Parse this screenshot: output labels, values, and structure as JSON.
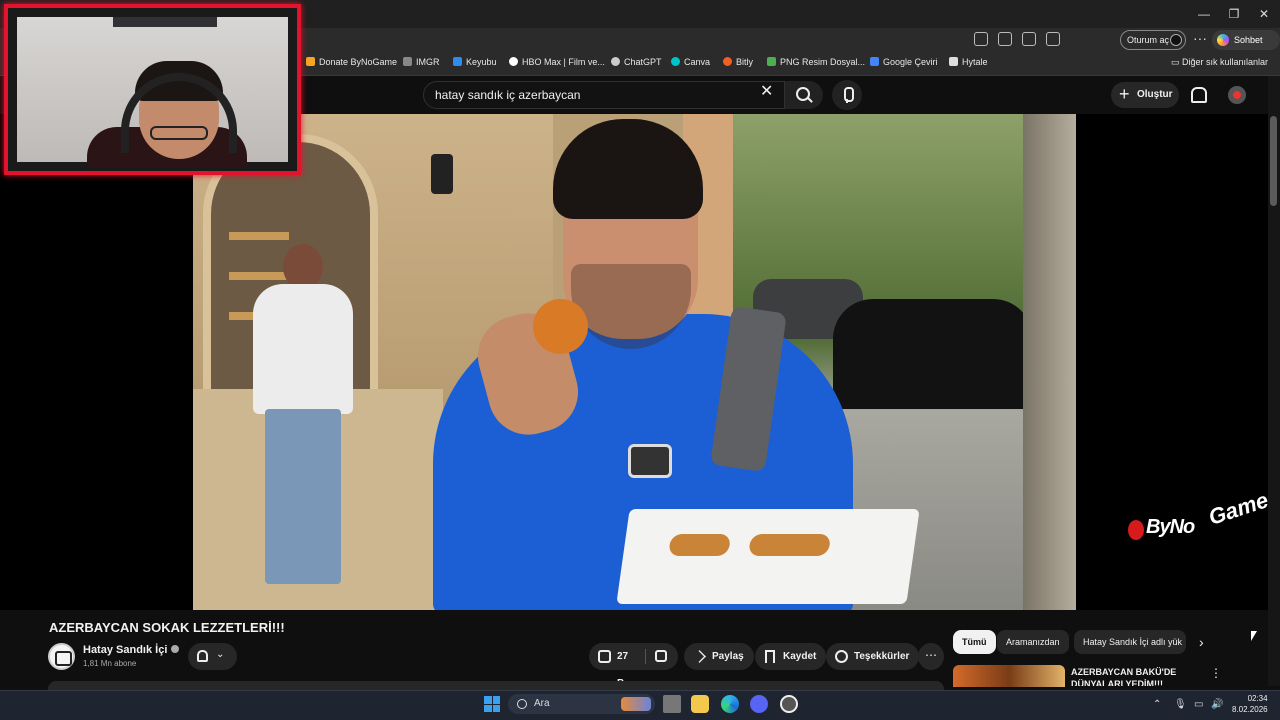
{
  "browser": {
    "sign_in_label": "Oturum aç",
    "copilot_label": "Sohbet et",
    "window_controls": [
      "minimize",
      "maximize",
      "close"
    ],
    "bookmarks": [
      {
        "label": "Donate ByNoGame",
        "color": "#f5a623"
      },
      {
        "label": "IMGR",
        "color": "#888888"
      },
      {
        "label": "Keyubu",
        "color": "#2d8cf0"
      },
      {
        "label": "HBO Max | Film ve...",
        "color": "#ffffff"
      },
      {
        "label": "ChatGPT",
        "color": "#cccccc"
      },
      {
        "label": "Canva",
        "color": "#00c4cc"
      },
      {
        "label": "Bitly",
        "color": "#ee6123"
      },
      {
        "label": "PNG Resim Dosyal...",
        "color": "#4caf50"
      },
      {
        "label": "Google Çeviri",
        "color": "#4285f4"
      },
      {
        "label": "Hytale",
        "color": "#dddddd"
      }
    ],
    "other_bookmarks_label": "Diğer sık kullanılanlar"
  },
  "youtube": {
    "search_query": "hatay sandık iç azerbaycan",
    "create_label": "Oluştur",
    "video": {
      "title": "AZERBAYCAN SOKAK LEZZETLERİ!!!",
      "watermark_line1": "ByNo",
      "watermark_line2": "Game"
    },
    "channel": {
      "name": "Hatay Sandık İçi",
      "subscribers": "1,81 Mn abone"
    },
    "actions": {
      "likes": "27 B",
      "share": "Paylaş",
      "save": "Kaydet",
      "thanks": "Teşekkürler",
      "more": "⋯"
    },
    "chips": [
      "Tümü",
      "Aramanızdan",
      "Hatay Sandık İçi adlı yük"
    ],
    "recommendation": {
      "title": "AZERBAYCAN BAKÜ'DE DÜNYALARI YEDİM!!!"
    }
  },
  "taskbar": {
    "search_label": "Ara",
    "time": "02:34",
    "date": "8.02.2026"
  },
  "colors": {
    "webcam_border": "#e2132c",
    "accent_blue": "#3aa0f0"
  }
}
